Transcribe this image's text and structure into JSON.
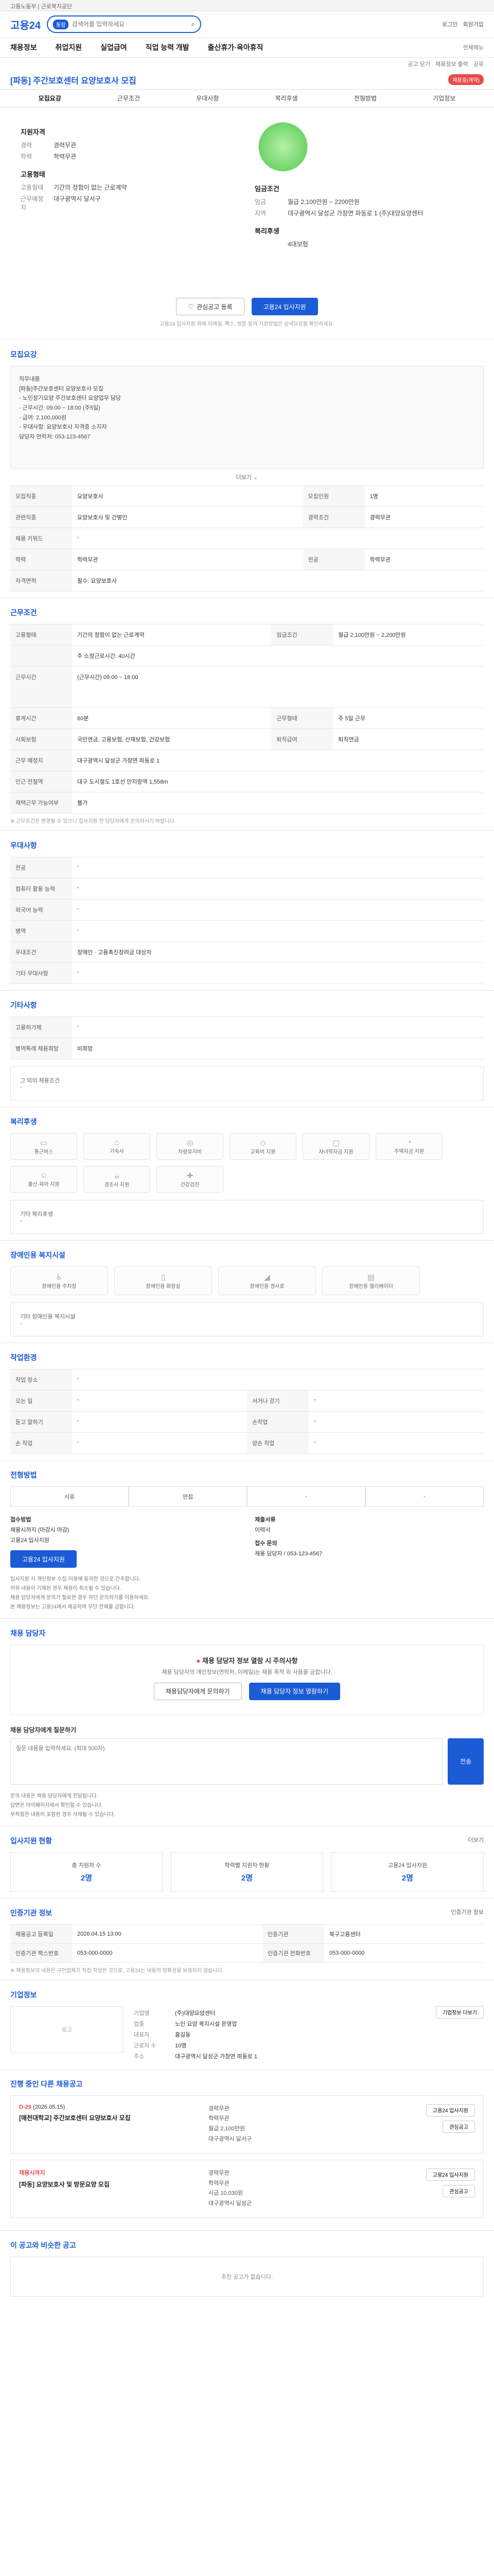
{
  "topbar": {
    "text": "고용노동부 | 근로복지공단"
  },
  "header": {
    "logo": "고용24",
    "search_placeholder": "검색어를 입력하세요",
    "search_chip": "통합",
    "right_links": [
      "로그인",
      "회원가입"
    ]
  },
  "gnb": {
    "items": [
      "채용정보",
      "취업지원",
      "실업급여",
      "직업 능력 개발",
      "출산휴가·육아휴직"
    ],
    "right": [
      "전체메뉴"
    ]
  },
  "utility": [
    "공고 닫기",
    "채용정보 출력",
    "공유"
  ],
  "job": {
    "title": "[파동] 주간보호센터 요양보호사 모집",
    "status_badge": "채용중(계약)",
    "tabs": [
      "모집요강",
      "근무조건",
      "우대사항",
      "복리후생",
      "전형방법",
      "기업정보"
    ],
    "summary": {
      "left_heading": "지원자격",
      "left_rows": [
        {
          "k": "경력",
          "v": "경력무관"
        },
        {
          "k": "학력",
          "v": "학력무관"
        }
      ],
      "left_heading2": "고용형태",
      "left_rows2": [
        {
          "k": "고용형태",
          "v": "기간의 정함이 없는 근로계약"
        },
        {
          "k": "근무예정지",
          "v": "대구광역시 달서구"
        }
      ],
      "right_heading": "임금조건",
      "right_rows": [
        {
          "k": "임금",
          "v": "월급 2,100만원 ~ 2200만원"
        },
        {
          "k": "지역",
          "v": "대구광역시 달성군 가창면 파동로 1 (주)대양요양센터"
        }
      ],
      "right_heading2": "복리후생",
      "right_rows2": [
        {
          "k": "",
          "v": "4대보험"
        }
      ]
    },
    "actions": {
      "interest": "관심공고 등록",
      "apply": "고용24 입사지원"
    },
    "note": "고용24 입사지원 외에 이메일, 팩스, 방문 등의 지원방법은 상세요강을 확인하세요."
  },
  "sections": {
    "recruit": {
      "heading": "모집요강",
      "desc_lines": [
        "직무내용",
        "[파동]주간보호센터 요양보호사 모집",
        "- 노인장기요양 주간보호센터 요양업무 담당",
        "- 근무시간: 09:00 ~ 18:00 (주5일)",
        "- 급여: 2,100,000원",
        "- 우대사항: 요양보호사 자격증 소지자",
        "담당자 연락처: 053-123-4567"
      ],
      "more": "더보기",
      "table": [
        {
          "k": "모집직종",
          "v": "요양보호사",
          "k2": "모집인원",
          "v2": "1명"
        },
        {
          "k": "관련직종",
          "v": "요양보호사 및 간병인",
          "k2": "경력조건",
          "v2": "경력무관"
        },
        {
          "k": "채용 키워드",
          "v": "-",
          "k2": "",
          "v2": ""
        },
        {
          "k": "학력",
          "v": "학력무관",
          "k2": "전공",
          "v2": "학력무관"
        },
        {
          "k": "자격면허",
          "v": "필수: 요양보호사",
          "k2": "",
          "v2": ""
        }
      ]
    },
    "conditions": {
      "heading": "근무조건",
      "table": [
        {
          "k": "고용형태",
          "v": "기간의 정함이 없는 근로계약",
          "k2": "임금조건",
          "v2": "월급 2,100만원 ~ 2,200만원"
        },
        {
          "k": "",
          "v": "주 소정근로시간: 40시간",
          "k2": "",
          "v2": ""
        },
        {
          "k": "근무시간",
          "v": "(근무시간) 09:00 ~ 18:00",
          "k2": "",
          "v2": ""
        },
        {
          "k": "휴게시간",
          "v": "60분",
          "k2": "근무형태",
          "v2": "주 5일 근무"
        },
        {
          "k": "사회보험",
          "v": "국민연금, 고용보험, 산재보험, 건강보험",
          "k2": "퇴직급여",
          "v2": "퇴직연금"
        },
        {
          "k": "근무 예정지",
          "v": "대구광역시 달성군 가창면 파동로 1",
          "k2": "",
          "v2": ""
        },
        {
          "k": "인근 전철역",
          "v": "대구 도시철도 1호선 안지랑역 1,558m",
          "k2": "",
          "v2": ""
        },
        {
          "k": "재택근무 가능여부",
          "v": "불가",
          "k2": "",
          "v2": ""
        }
      ],
      "note": "※ 근무조건은 변경될 수 있으니 입사지원 전 담당자에게 문의하시기 바랍니다."
    },
    "preferred": {
      "heading": "우대사항",
      "table": [
        {
          "k": "전공",
          "v": "-"
        },
        {
          "k": "컴퓨터 활용 능력",
          "v": "-"
        },
        {
          "k": "외국어 능력",
          "v": "-"
        },
        {
          "k": "병역",
          "v": "-"
        },
        {
          "k": "우대조건",
          "v": "장애인 · 고용촉진장려금 대상자"
        },
        {
          "k": "기타 우대사항",
          "v": "-"
        }
      ]
    },
    "other": {
      "heading": "기타사항",
      "table": [
        {
          "k": "고용허가제",
          "v": "-"
        },
        {
          "k": "병역특례 채용희망",
          "v": "비희망"
        }
      ],
      "more_label": "그 외의 채용조건",
      "more_value": "-"
    },
    "welfare": {
      "heading": "복리후생",
      "items": [
        {
          "icon": "briefcase-icon",
          "glyph": "▭",
          "label": "통근버스"
        },
        {
          "icon": "house-icon",
          "glyph": "⌂",
          "label": "기숙사"
        },
        {
          "icon": "meal-icon",
          "glyph": "◎",
          "label": "차량유지비"
        },
        {
          "icon": "gift-icon",
          "glyph": "◇",
          "label": "교육비 지원"
        },
        {
          "icon": "car-icon",
          "glyph": "▢",
          "label": "자녀학자금 지원"
        },
        {
          "icon": "clock-icon",
          "glyph": "◔",
          "label": "주택자금 지원"
        },
        {
          "icon": "baby-icon",
          "glyph": "☺",
          "label": "출산·육아 지원"
        },
        {
          "icon": "coffee-icon",
          "glyph": "☕",
          "label": "경조사 지원"
        },
        {
          "icon": "health-icon",
          "glyph": "✚",
          "label": "건강검진"
        }
      ],
      "etc_label": "기타 복리후생",
      "etc_value": "-"
    },
    "disabled": {
      "heading": "장애인용 복지시설",
      "items": [
        {
          "icon": "wheelchair-icon",
          "glyph": "♿",
          "label": "장애인용 주차장"
        },
        {
          "icon": "toilet-icon",
          "glyph": "▯",
          "label": "장애인용 화장실"
        },
        {
          "icon": "ramp-icon",
          "glyph": "◢",
          "label": "장애인용 경사로"
        },
        {
          "icon": "elevator-icon",
          "glyph": "▤",
          "label": "장애인용 엘리베이터"
        }
      ],
      "etc_label": "기타 장애인용 복지시설",
      "etc_value": "-"
    },
    "workenv": {
      "heading": "작업환경",
      "table": [
        {
          "k": "작업 장소",
          "v": "-",
          "k2": "",
          "v2": ""
        },
        {
          "k": "오는 일",
          "v": "-",
          "k2": "서거나 걷기",
          "v2": "-"
        },
        {
          "k": "듣고 말하기",
          "v": "-",
          "k2": "손작업",
          "v2": "-"
        },
        {
          "k": "손 작업",
          "v": "-",
          "k2": "양손 작업",
          "v2": "-"
        }
      ]
    },
    "process": {
      "heading": "전형방법",
      "steps": [
        "서류",
        "면접",
        "-",
        "-"
      ],
      "apply_heading": "접수방법",
      "apply_lines": [
        "채용시까지 (마감시 마감)",
        "고용24 입사지원"
      ],
      "apply_button": "고용24 입사지원",
      "doc_heading": "제출서류",
      "doc_lines": [
        "이력서"
      ],
      "contact_heading": "접수 문의",
      "contact_lines": [
        "채용 담당자 / 053-123-4567"
      ],
      "bullets": [
        "입사지원 시 개인정보 수집·이용에 동의한 것으로 간주합니다.",
        "허위 내용이 기재된 경우 채용이 취소될 수 있습니다.",
        "채용 담당자에게 문의가 필요한 경우 하단 문의하기를 이용하세요.",
        "본 채용정보는 고용24에서 제공하며 무단 전재를 금합니다."
      ]
    },
    "manager": {
      "heading": "채용 담당자",
      "notice_title_pre": "채용 담당자 정보 열람 시 주의사항",
      "notice_text": "채용 담당자의 개인정보(연락처, 이메일)는 채용 목적 외 사용을 금합니다.",
      "btn_a": "채용담당자에게 문의하기",
      "btn_b": "채용 담당자 정보 열람하기",
      "inquiry_label": "채용 담당자에게 질문하기",
      "inquiry_placeholder": "질문 내용을 입력하세요. (최대 500자)",
      "send": "전송",
      "bullets": [
        "문의 내용은 채용 담당자에게 전달됩니다.",
        "답변은 마이페이지에서 확인할 수 있습니다.",
        "부적절한 내용이 포함된 경우 삭제될 수 있습니다."
      ]
    },
    "status": {
      "heading": "입사지원 현황",
      "link": "더보기",
      "stats": [
        {
          "label": "총 지원자 수",
          "value": "2명"
        },
        {
          "label": "학력별 지원자 현황",
          "value": "2명"
        },
        {
          "label": "고용24 입사지원",
          "value": "2명"
        }
      ]
    },
    "reginfo": {
      "heading": "인증기관 정보",
      "link": "인증기관 정보",
      "table": [
        {
          "k": "채용공고 등록일",
          "v": "2026.04.15 13:00",
          "k2": "인증기관",
          "v2": "북구고용센터"
        },
        {
          "k": "인증기관 팩스번호",
          "v": "053-000-0000",
          "k2": "인증기관 전화번호",
          "v2": "053-000-0000"
        }
      ],
      "note": "※ 채용정보의 내용은 구인업체가 직접 작성한 것으로, 고용24는 내용의 정확성을 보증하지 않습니다."
    },
    "company": {
      "heading": "기업정보",
      "logo_placeholder": "로고",
      "rows": [
        {
          "k": "기업명",
          "v": "(주)대양요양센터"
        },
        {
          "k": "업종",
          "v": "노인 요양 복지시설 운영업"
        },
        {
          "k": "대표자",
          "v": "홍길동"
        },
        {
          "k": "근로자 수",
          "v": "10명"
        },
        {
          "k": "주소",
          "v": "대구광역시 달성군 가창면 파동로 1"
        }
      ],
      "btn": "기업정보 더보기"
    },
    "others": {
      "heading": "진행 중인 다른 채용공고",
      "jobs": [
        {
          "dday": "D-29",
          "date": "(2026.05.15)",
          "title": "[매천대학교] 주간보호센터 요양보호사 모집",
          "info": [
            "경력무관",
            "학력무관",
            "월급 2,100만원",
            "대구광역시 달서구"
          ],
          "btn1": "고용24 입사지원",
          "btn2": "관심공고"
        },
        {
          "dday": "채용시까지",
          "date": "",
          "title": "[파동] 요양보호사 및 방문요양 모집",
          "info": [
            "경력무관",
            "학력무관",
            "시급 10,030원",
            "대구광역시 달성군"
          ],
          "btn1": "고용24 입사지원",
          "btn2": "관심공고"
        }
      ]
    },
    "recommend": {
      "heading": "이 공고와 비슷한 공고",
      "empty": "추천 공고가 없습니다."
    }
  }
}
